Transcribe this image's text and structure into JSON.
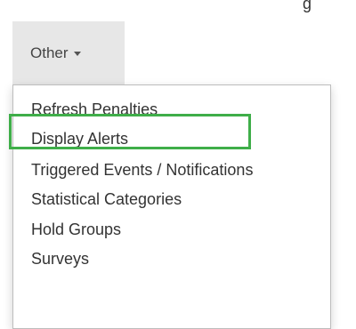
{
  "header": {
    "cutoff_text": "g"
  },
  "other_button": {
    "label": "Other"
  },
  "dropdown": {
    "items": [
      {
        "label": "Refresh Penalties"
      },
      {
        "label": "Display Alerts"
      },
      {
        "label": "Triggered Events / Notifications"
      },
      {
        "label": "Statistical Categories",
        "highlighted": true
      },
      {
        "label": "Hold Groups"
      },
      {
        "label": "Surveys"
      }
    ]
  },
  "colors": {
    "highlight": "#3fae49",
    "button_bg": "#e7e7e7",
    "text": "#333333"
  }
}
